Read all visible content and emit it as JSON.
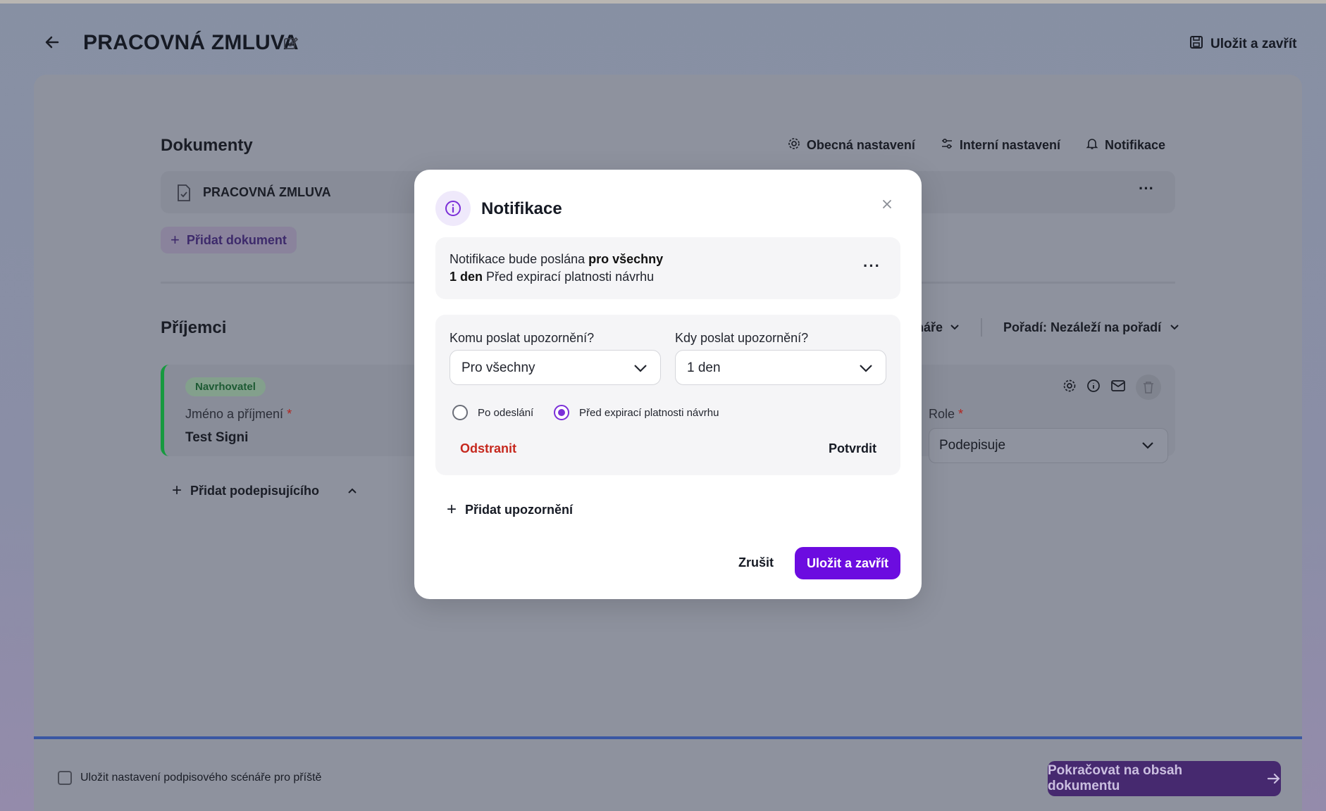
{
  "header": {
    "title": "PRACOVNÁ ZMLUVA",
    "save_label": "Uložit a zavřít"
  },
  "documents": {
    "section_title": "Dokumenty",
    "tabs": [
      "Obecná nastavení",
      "Interní nastavení",
      "Notifikace"
    ],
    "items": [
      "PRACOVNÁ ZMLUVA"
    ],
    "add_label": "Přidat dokument"
  },
  "recipients": {
    "section_title": "Příjemci",
    "filter_partial": "náře",
    "order_label": "Pořadí: Nezáleží na pořadí",
    "signer": {
      "badge": "Navrhovatel",
      "name_label": "Jméno a příjmení",
      "required_mark": "*",
      "name_value": "Test Signi",
      "role_label": "Role",
      "role_value": "Podepisuje"
    },
    "add_signer_label": "Přidat podepisujícího"
  },
  "footer": {
    "save_setting_label": "Uložit nastavení podpisového scénáře pro příště",
    "continue_label": "Pokračovat na obsah dokumentu"
  },
  "modal": {
    "title": "Notifikace",
    "summary": {
      "prefix": "Notifikace bude poslána ",
      "recipient": "pro všechny",
      "time": "1 den",
      "when": " Před expirací platnosti návrhu"
    },
    "editor": {
      "who_label": "Komu poslat upozornění?",
      "who_value": "Pro všechny",
      "when_label": "Kdy poslat upozornění?",
      "when_value": "1 den",
      "radio_options": [
        "Po odeslání",
        "Před expirací platnosti návrhu"
      ],
      "selected_radio": "Před expirací platnosti návrhu",
      "remove_label": "Odstranit",
      "confirm_label": "Potvrdit"
    },
    "add_notice_label": "Přidat upozornění",
    "cancel_label": "Zrušit",
    "save_label": "Uložit a zavřít"
  },
  "colors": {
    "primary": "#6c0ce0",
    "danger": "#c6281e",
    "success_bar": "#179a3f",
    "footer_accent": "#3a57a3"
  }
}
